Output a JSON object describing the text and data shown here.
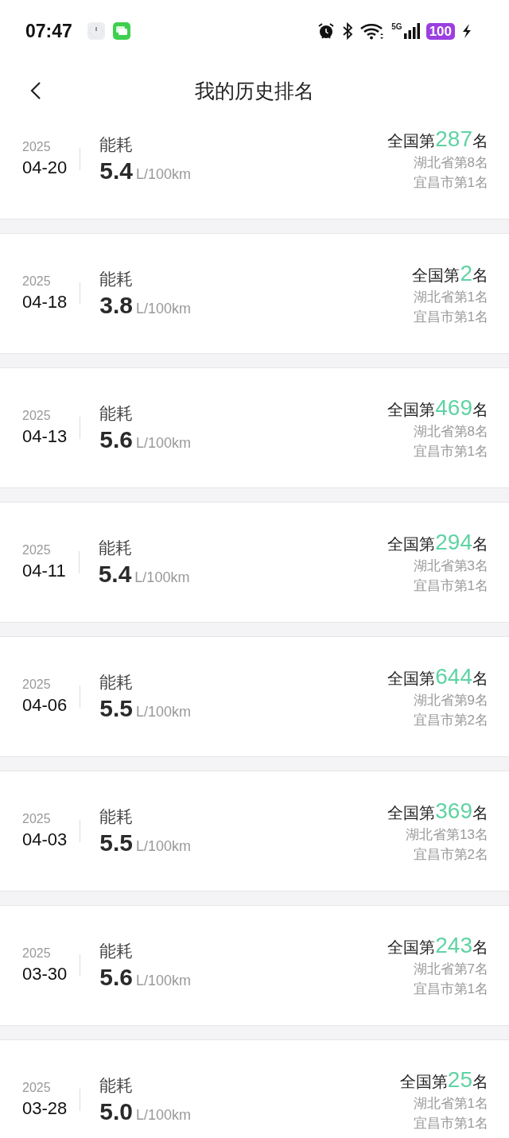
{
  "status_bar": {
    "time": "07:47",
    "network": "5G",
    "battery": "100"
  },
  "header": {
    "title": "我的历史排名"
  },
  "records": [
    {
      "year": "2025",
      "date": "04-20",
      "metric": "能耗",
      "value": "5.4",
      "unit": "L/100km",
      "national": {
        "prefix": "全国第",
        "number": "287",
        "suffix": "名"
      },
      "province": "湖北省第8名",
      "city": "宜昌市第1名"
    },
    {
      "year": "2025",
      "date": "04-18",
      "metric": "能耗",
      "value": "3.8",
      "unit": "L/100km",
      "national": {
        "prefix": "全国第",
        "number": "2",
        "suffix": "名"
      },
      "province": "湖北省第1名",
      "city": "宜昌市第1名"
    },
    {
      "year": "2025",
      "date": "04-13",
      "metric": "能耗",
      "value": "5.6",
      "unit": "L/100km",
      "national": {
        "prefix": "全国第",
        "number": "469",
        "suffix": "名"
      },
      "province": "湖北省第8名",
      "city": "宜昌市第1名"
    },
    {
      "year": "2025",
      "date": "04-11",
      "metric": "能耗",
      "value": "5.4",
      "unit": "L/100km",
      "national": {
        "prefix": "全国第",
        "number": "294",
        "suffix": "名"
      },
      "province": "湖北省第3名",
      "city": "宜昌市第1名"
    },
    {
      "year": "2025",
      "date": "04-06",
      "metric": "能耗",
      "value": "5.5",
      "unit": "L/100km",
      "national": {
        "prefix": "全国第",
        "number": "644",
        "suffix": "名"
      },
      "province": "湖北省第9名",
      "city": "宜昌市第2名"
    },
    {
      "year": "2025",
      "date": "04-03",
      "metric": "能耗",
      "value": "5.5",
      "unit": "L/100km",
      "national": {
        "prefix": "全国第",
        "number": "369",
        "suffix": "名"
      },
      "province": "湖北省第13名",
      "city": "宜昌市第2名"
    },
    {
      "year": "2025",
      "date": "03-30",
      "metric": "能耗",
      "value": "5.6",
      "unit": "L/100km",
      "national": {
        "prefix": "全国第",
        "number": "243",
        "suffix": "名"
      },
      "province": "湖北省第7名",
      "city": "宜昌市第1名"
    },
    {
      "year": "2025",
      "date": "03-28",
      "metric": "能耗",
      "value": "5.0",
      "unit": "L/100km",
      "national": {
        "prefix": "全国第",
        "number": "25",
        "suffix": "名"
      },
      "province": "湖北省第1名",
      "city": "宜昌市第1名"
    }
  ]
}
